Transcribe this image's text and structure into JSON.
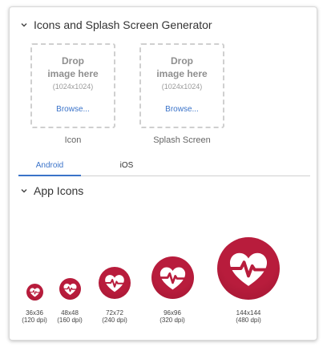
{
  "generator": {
    "title": "Icons and Splash Screen Generator",
    "dropzones": [
      {
        "line1": "Drop",
        "line2": "image here",
        "size": "(1024x1024)",
        "browse": "Browse...",
        "caption": "Icon"
      },
      {
        "line1": "Drop",
        "line2": "image here",
        "size": "(1024x1024)",
        "browse": "Browse...",
        "caption": "Splash Screen"
      }
    ]
  },
  "tabs": [
    {
      "label": "Android",
      "active": true
    },
    {
      "label": "iOS",
      "active": false
    }
  ],
  "app_icons": {
    "title": "App Icons",
    "colors": {
      "fill": "#b81c3c",
      "fill_dark": "#a01632",
      "glyph": "#ffffff"
    },
    "items": [
      {
        "size": "36x36",
        "dpi": "(120 dpi)"
      },
      {
        "size": "48x48",
        "dpi": "(160 dpi)"
      },
      {
        "size": "72x72",
        "dpi": "(240 dpi)"
      },
      {
        "size": "96x96",
        "dpi": "(320 dpi)"
      },
      {
        "size": "144x144",
        "dpi": "(480 dpi)"
      }
    ]
  }
}
